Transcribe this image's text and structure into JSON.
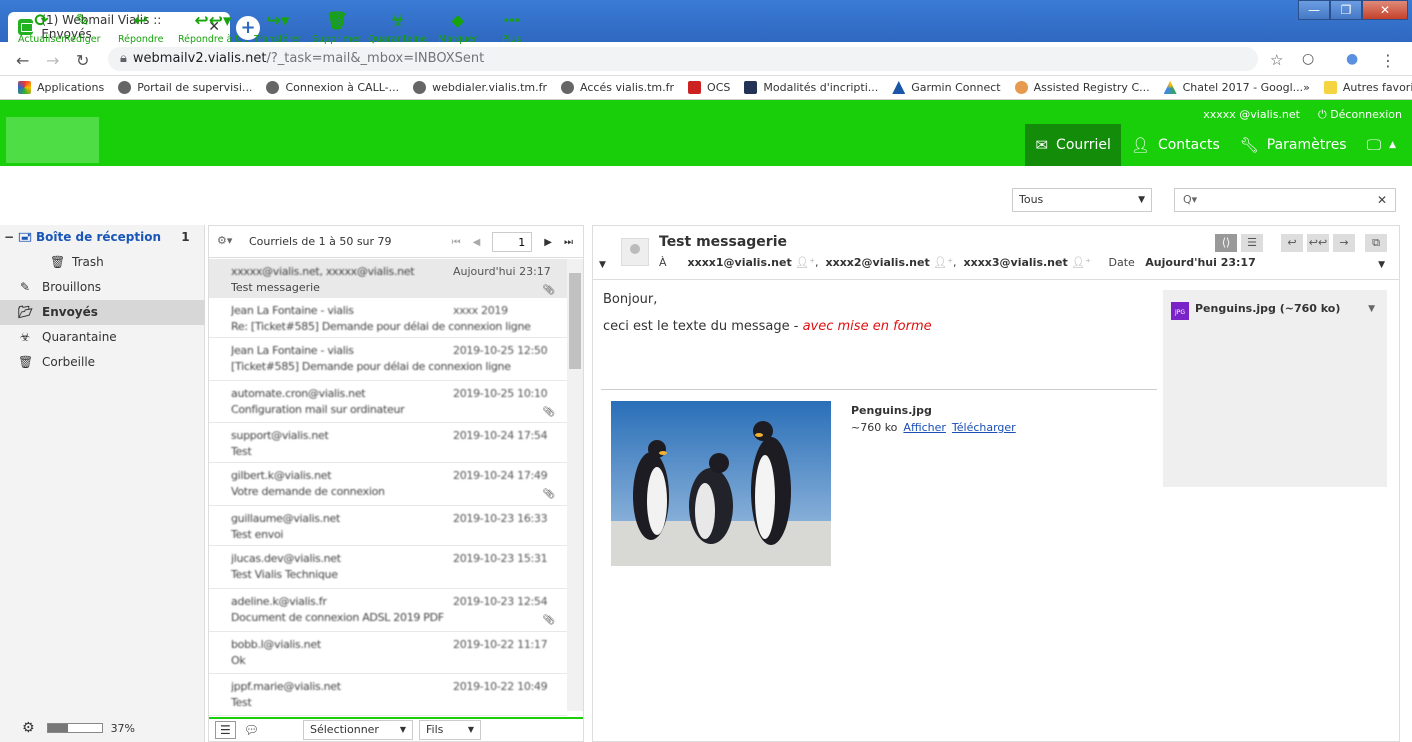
{
  "browser": {
    "tab_title": "(1) Webmail Vialis :: Envoyés",
    "url_main": "webmailv2.vialis.net",
    "url_rest": "/?_task=mail&_mbox=INBOXSent",
    "bookmarks": [
      "Applications",
      "Portail de supervisi...",
      "Connexion à CALL-...",
      "webdialer.vialis.tm.fr",
      "Accés vialis.tm.fr",
      "OCS",
      "Modalités d'incripti...",
      "Garmin Connect",
      "Assisted Registry C...",
      "Chatel 2017 - Googl..."
    ],
    "more": "»",
    "other_bookmarks": "Autres favoris"
  },
  "header": {
    "user": "xxxxx @vialis.net",
    "logout": "Déconnexion",
    "nav": {
      "mail": "Courriel",
      "contacts": "Contacts",
      "settings": "Paramètres"
    }
  },
  "toolbar": {
    "refresh": "Actualiser",
    "compose": "Rédiger",
    "reply": "Répondre",
    "reply_all": "Répondre à t...",
    "forward": "Transférer",
    "delete": "Supprimer",
    "quarantine": "Quarantaine",
    "mark": "Marquer",
    "more": "Plus",
    "filter": "Tous",
    "search_placeholder": "Q▾"
  },
  "folders": {
    "inbox": "Boîte de réception",
    "inbox_count": "1",
    "trash_sub": "Trash",
    "drafts": "Brouillons",
    "sent": "Envoyés",
    "quarantine": "Quarantaine",
    "bin": "Corbeille",
    "quota_percent": 37,
    "quota_label": "37%"
  },
  "list": {
    "count": "Courriels de 1 à 50 sur 79",
    "page": "1",
    "rows": [
      {
        "from": "xxxxx@vialis.net, xxxxx@vialis.net",
        "date": "Aujourd'hui 23:17",
        "subject": "Test messagerie"
      },
      {
        "from": "Jean La Fontaine - vialis",
        "date": "xxxx 2019",
        "subject": "Re: [Ticket#585] Demande pour délai de connexion ligne"
      },
      {
        "from": "Jean La Fontaine - vialis",
        "date": "2019-10-25 12:50",
        "subject": "[Ticket#585] Demande pour délai de connexion ligne"
      },
      {
        "from": "automate.cron@vialis.net",
        "date": "2019-10-25 10:10",
        "subject": "Configuration mail sur ordinateur"
      },
      {
        "from": "support@vialis.net",
        "date": "2019-10-24 17:54",
        "subject": "Test"
      },
      {
        "from": "gilbert.k@vialis.net",
        "date": "2019-10-24 17:49",
        "subject": "Votre demande de connexion"
      },
      {
        "from": "guillaume@vialis.net",
        "date": "2019-10-23 16:33",
        "subject": "Test envoi"
      },
      {
        "from": "jlucas.dev@vialis.net",
        "date": "2019-10-23 15:31",
        "subject": "Test Vialis Technique"
      },
      {
        "from": "adeline.k@vialis.fr",
        "date": "2019-10-23 12:54",
        "subject": "Document de connexion ADSL 2019 PDF"
      },
      {
        "from": "bobb.l@vialis.net",
        "date": "2019-10-22 11:17",
        "subject": "Ok"
      },
      {
        "from": "jppf.marie@vialis.net",
        "date": "2019-10-22 10:49",
        "subject": "Test"
      }
    ],
    "select_label": "Sélectionner",
    "threads_label": "Fils"
  },
  "preview": {
    "subject": "Test messagerie",
    "to_label": "À",
    "recipients": [
      "xxxx1@vialis.net",
      "xxxx2@vialis.net",
      "xxxx3@vialis.net"
    ],
    "date_label": "Date",
    "date": "Aujourd'hui 23:17",
    "body_greeting": "Bonjour,",
    "body_text": "ceci est le texte du message - ",
    "body_styled": "avec mise en forme",
    "attachment_name": "Penguins.jpg",
    "attachment_size": "~760 ko",
    "attachment_panel": "Penguins.jpg (~760 ko)",
    "view": "Afficher",
    "download": "Télécharger"
  }
}
